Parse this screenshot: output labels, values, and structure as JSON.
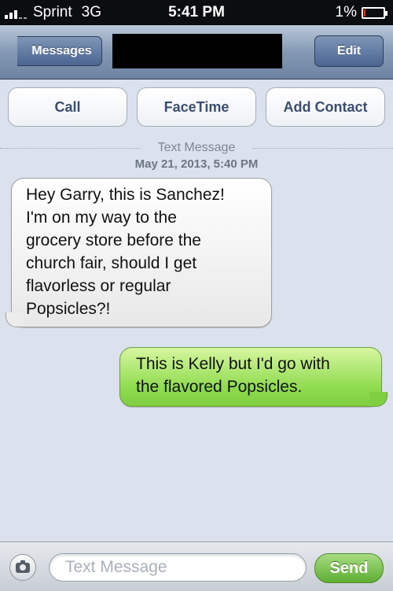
{
  "status_bar": {
    "carrier": "Sprint",
    "network": "3G",
    "time": "5:41 PM",
    "battery": "1%"
  },
  "nav": {
    "back_label": "Messages",
    "edit_label": "Edit"
  },
  "actions": {
    "call": "Call",
    "facetime": "FaceTime",
    "add_contact": "Add Contact"
  },
  "thread": {
    "header": "Text Message",
    "timestamp": "May 21, 2013, 5:40 PM",
    "messages": [
      {
        "direction": "incoming",
        "lines": [
          "Hey Garry, this is Sanchez!",
          "I'm on my way to the",
          "grocery store before the",
          "church fair, should I get",
          "flavorless or regular",
          "Popsicles?!"
        ]
      },
      {
        "direction": "outgoing",
        "lines": [
          "This is Kelly but I'd go with",
          "the flavored Popsicles."
        ]
      }
    ]
  },
  "composer": {
    "placeholder": "Text Message",
    "send_label": "Send"
  },
  "colors": {
    "outgoing_bubble": "#8edb4e",
    "incoming_bubble": "#ffffff",
    "nav_bar": "#8499b5"
  }
}
